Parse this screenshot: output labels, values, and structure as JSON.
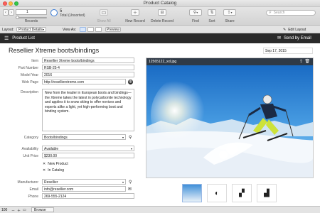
{
  "window": {
    "title": "Product Catalog"
  },
  "toolbar": {
    "record_current": "1",
    "records_label": "Records",
    "total_count": "5",
    "total_label": "Total (Unsorted)",
    "show_all": "Show All",
    "new_record": "New Record",
    "delete_record": "Delete Record",
    "find": "Find",
    "sort": "Sort",
    "share": "Share",
    "search_placeholder": "Search"
  },
  "layoutbar": {
    "layout_label": "Layout:",
    "layout_value": "Product Details",
    "view_as_label": "View As:",
    "preview": "Preview",
    "edit_layout": "Edit Layout"
  },
  "header": {
    "product_list": "Product List",
    "send_by_email": "Send by Email"
  },
  "product": {
    "title": "Resellier Xtreme boots/bindings",
    "date": "Sep 17, 2015"
  },
  "fields": {
    "item_label": "Item",
    "item": "Resellier Xtreme boots/bindings",
    "part_number_label": "Part Number",
    "part_number": "RSB-25-4",
    "model_year_label": "Model Year",
    "model_year": "2016",
    "web_page_label": "Web Page",
    "web_page": "http://resellierxtreme.com",
    "description_label": "Description",
    "description": "New from the leader in European boots and bindings—the Xtreme takes the latest in polycarbonite technology and applies it to snow skiing to offer novices and experts alike a light, yet high-performing boot and binding system.",
    "category_label": "Category",
    "category": "Boots/bindings",
    "availability_label": "Availability",
    "availability": "Available",
    "unit_price_label": "Unit Price",
    "unit_price": "$230.00",
    "new_product": "New Product",
    "in_catalog": "In Catalog",
    "manufacturer_label": "Manufacturer",
    "manufacturer": "Resellier",
    "email_label": "Email",
    "email": "info@resellier.com",
    "phone_label": "Phone",
    "phone": "269-555-2124"
  },
  "image": {
    "filename": "12565122_xxl.jpg"
  },
  "statusbar": {
    "zoom": "100",
    "mode": "Browse"
  }
}
